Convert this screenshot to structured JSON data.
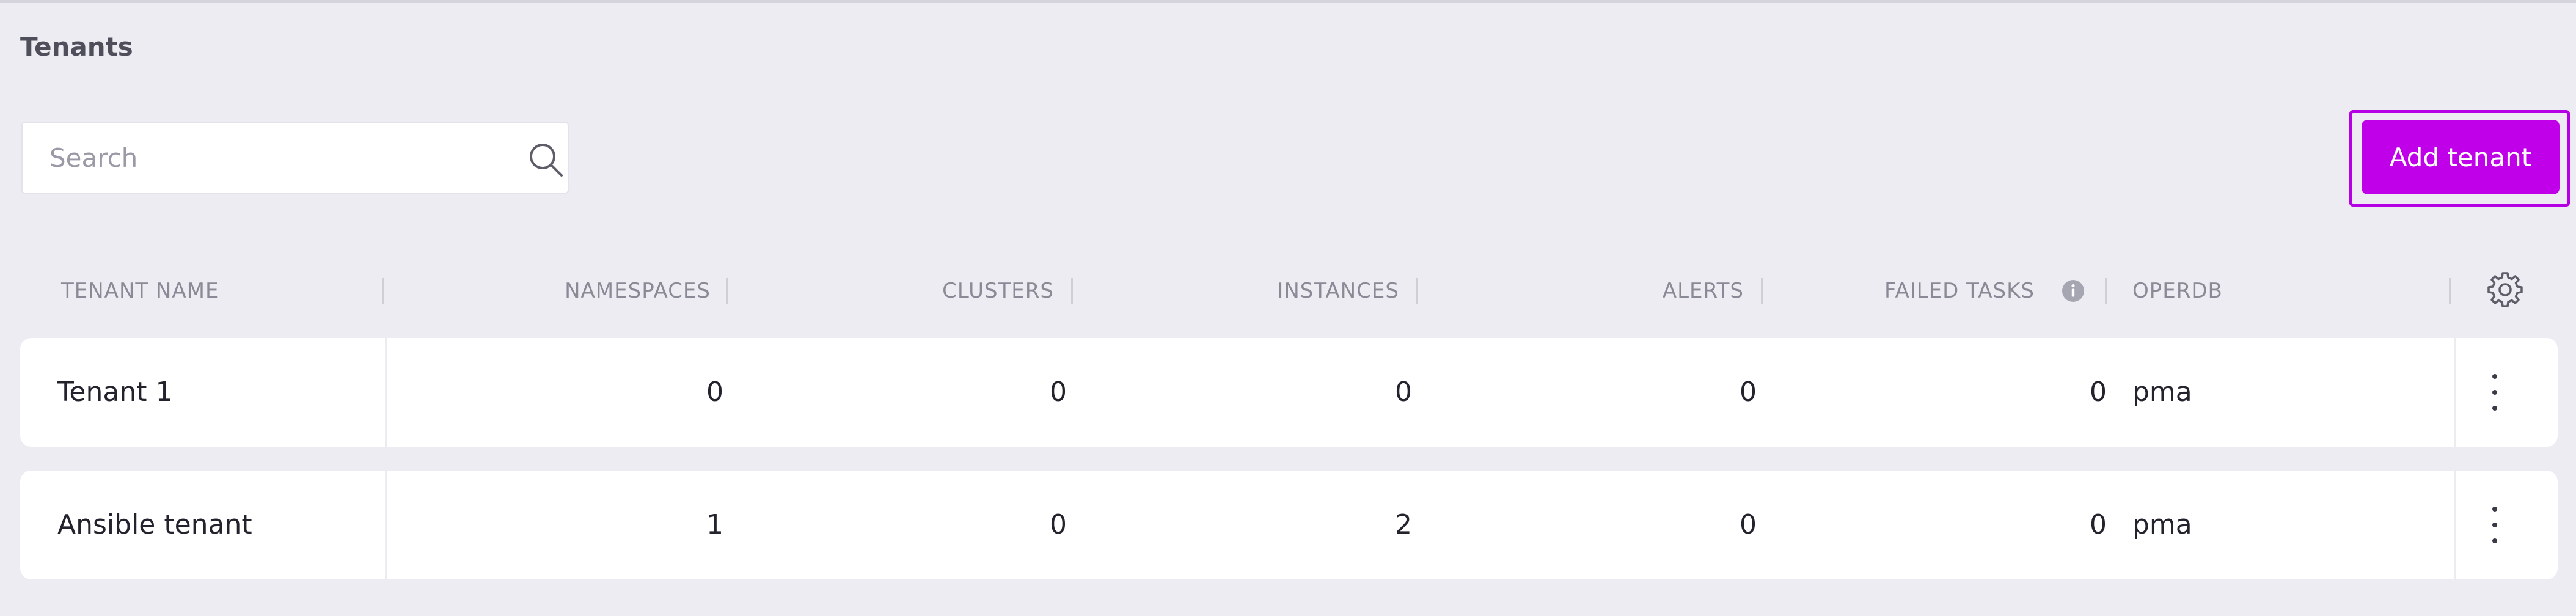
{
  "page": {
    "title": "Tenants"
  },
  "search": {
    "placeholder": "Search",
    "value": "",
    "icon": "search-icon"
  },
  "toolbar": {
    "add_label": "Add tenant",
    "accent_color": "#c000e8"
  },
  "table": {
    "columns": [
      {
        "key": "name",
        "label": "TENANT NAME"
      },
      {
        "key": "namespaces",
        "label": "NAMESPACES"
      },
      {
        "key": "clusters",
        "label": "CLUSTERS"
      },
      {
        "key": "instances",
        "label": "INSTANCES"
      },
      {
        "key": "alerts",
        "label": "ALERTS"
      },
      {
        "key": "failed_tasks",
        "label": "FAILED TASKS",
        "icon": "info-icon"
      },
      {
        "key": "operdb",
        "label": "OPERDB"
      }
    ],
    "settings_icon": "gear-icon",
    "row_menu_icon": "kebab-menu-icon",
    "rows": [
      {
        "name": "Tenant 1",
        "namespaces": "0",
        "clusters": "0",
        "instances": "0",
        "alerts": "0",
        "failed_tasks": "0",
        "operdb": "pma"
      },
      {
        "name": "Ansible tenant",
        "namespaces": "1",
        "clusters": "0",
        "instances": "2",
        "alerts": "0",
        "failed_tasks": "0",
        "operdb": "pma"
      }
    ]
  }
}
